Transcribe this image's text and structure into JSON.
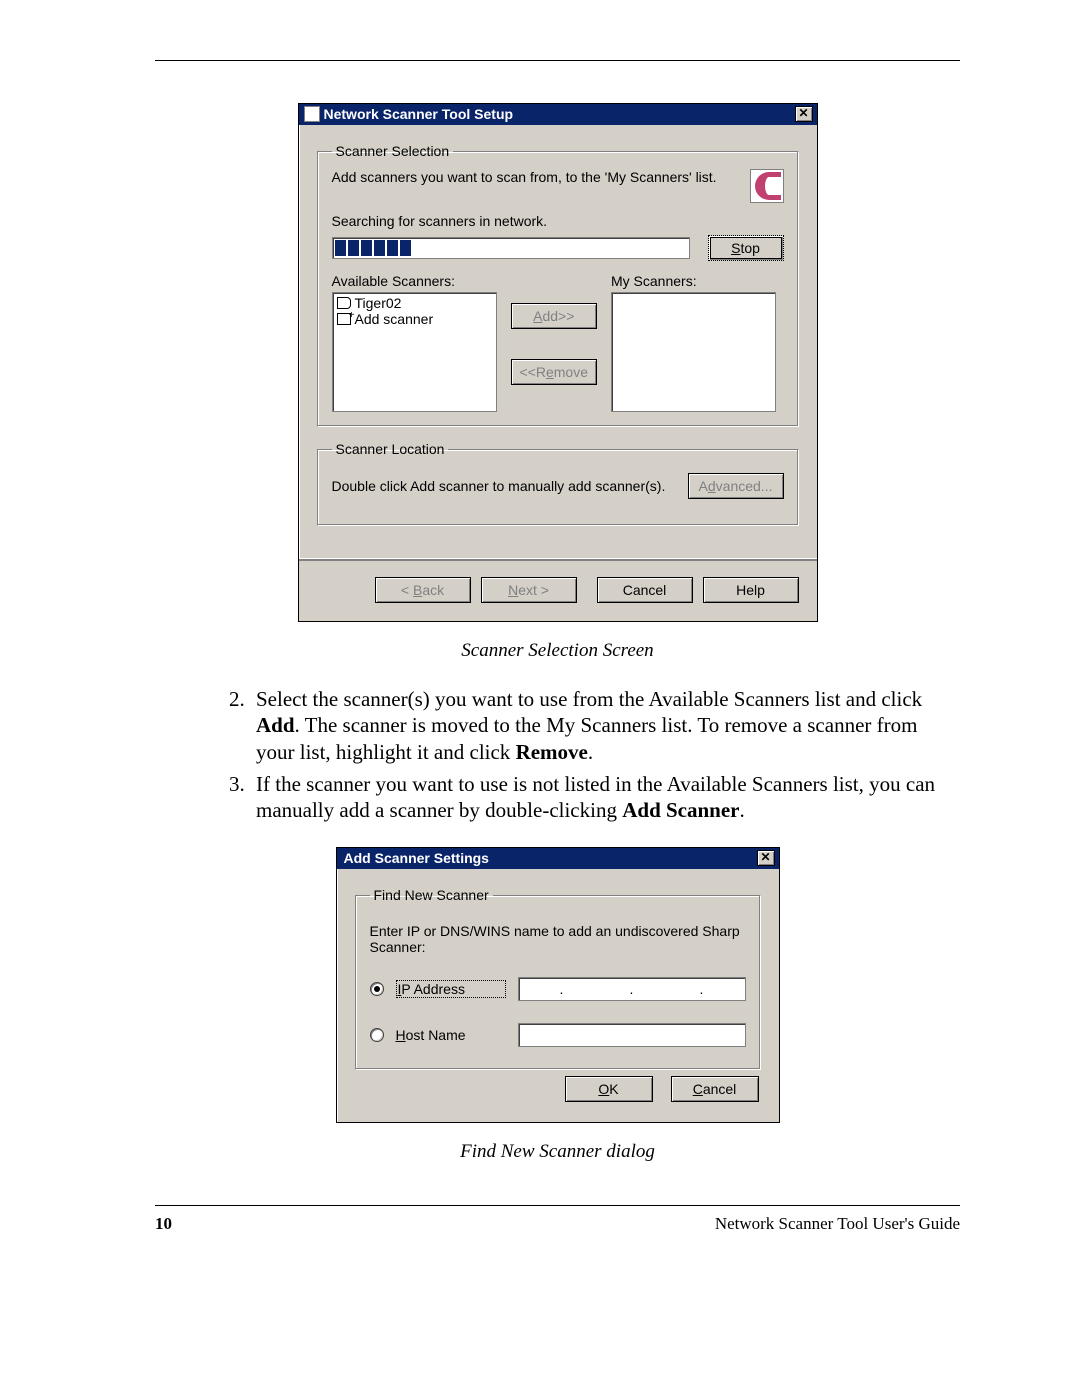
{
  "dialog1": {
    "title": "Network Scanner Tool Setup",
    "close": "✕",
    "group_selection": "Scanner Selection",
    "selection_text": "Add scanners you want to scan from, to the 'My Scanners' list.",
    "searching": "Searching for scanners in network.",
    "stop_pre": "S",
    "stop_mid": "top",
    "available_label": "Available Scanners:",
    "my_label": "My Scanners:",
    "available_items": {
      "item0": "Tiger02",
      "item1": "Add scanner"
    },
    "add_pre": "A",
    "add_post": "dd>>",
    "remove_pre": "<<R",
    "remove_mid": "emove",
    "group_location": "Scanner Location",
    "location_text": "Double click Add scanner to manually add scanner(s).",
    "advanced_pre": "A",
    "advanced_mid": "d",
    "advanced_post": "vanced...",
    "back_pre": "< ",
    "back_u": "B",
    "back_post": "ack",
    "next_u": "N",
    "next_post": "ext >",
    "cancel": "Cancel",
    "help": "Help"
  },
  "caption1": "Scanner Selection Screen",
  "step2_a": "Select the scanner(s) you want to use from the Available Scanners list and click ",
  "step2_add": "Add",
  "step2_b": ". The scanner is moved to the My Scanners list. To remove a scanner from your list, highlight it and click ",
  "step2_remove": "Remove",
  "step2_c": ".",
  "step3_a": "If the scanner you want to use is not listed in the Available Scanners list, you can manually add a scanner by double-clicking ",
  "step3_addscanner": "Add Scanner",
  "step3_b": ".",
  "dialog2": {
    "title": "Add Scanner Settings",
    "close": "✕",
    "group_find": "Find New Scanner",
    "find_text": "Enter IP or DNS/WINS name to add an undiscovered Sharp Scanner:",
    "ip_u": "I",
    "ip_post": "P Address",
    "host_u": "H",
    "host_post": "ost Name",
    "ip_dot": ".",
    "ok_u": "O",
    "ok_post": "K",
    "cancel_u": "C",
    "cancel_post": "ancel"
  },
  "caption2": "Find New Scanner dialog",
  "footer": {
    "page": "10",
    "guide": "Network Scanner Tool User's Guide"
  }
}
